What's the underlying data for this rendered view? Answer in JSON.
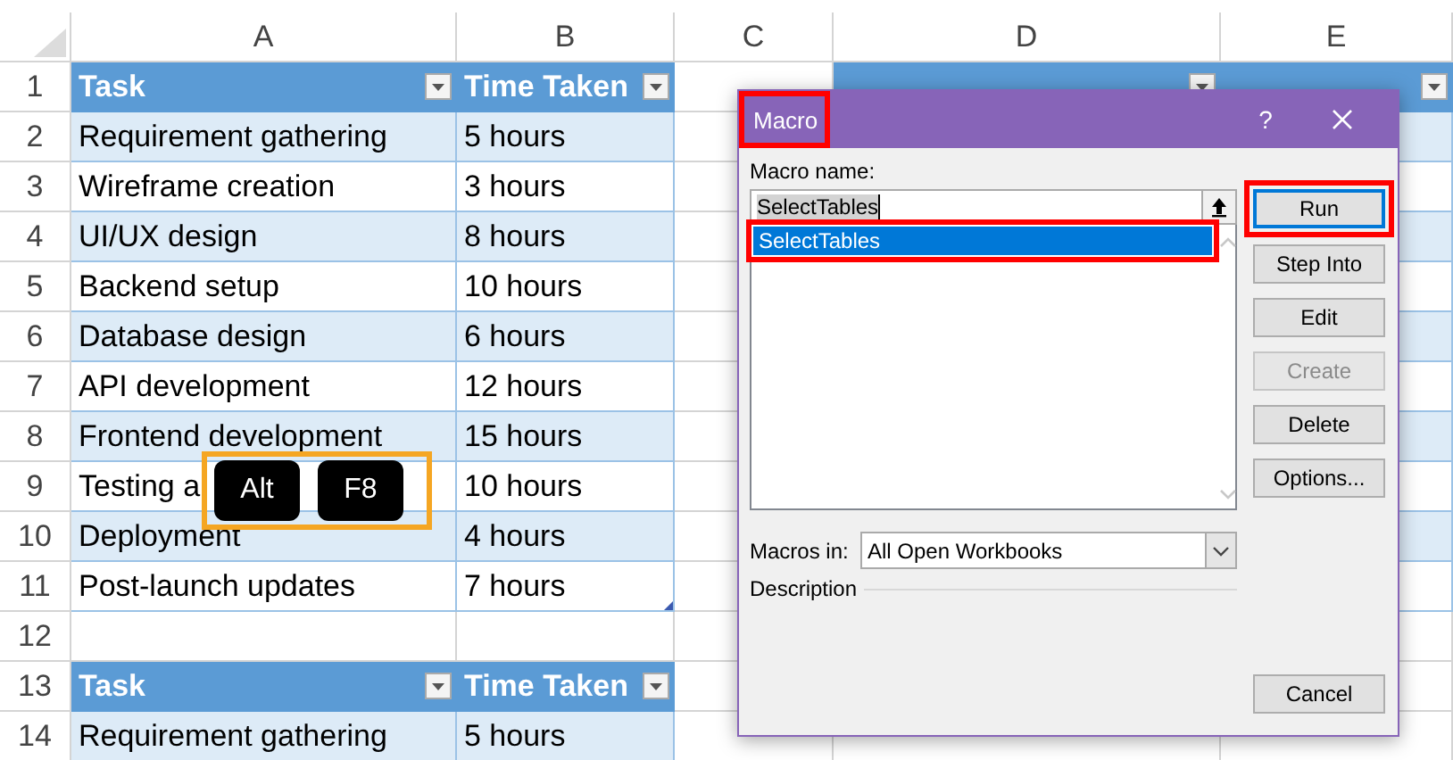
{
  "sheet": {
    "columns": [
      {
        "label": "A"
      },
      {
        "label": "B"
      },
      {
        "label": "C"
      },
      {
        "label": "D"
      },
      {
        "label": "E"
      }
    ],
    "rows": [
      {
        "number": "1",
        "cells": [
          {
            "kind": "header",
            "text": "Task",
            "filter": true
          },
          {
            "kind": "header",
            "text": "Time Taken",
            "filter": true
          },
          {
            "kind": "blank"
          },
          {
            "kind": "header",
            "filter": true
          },
          {
            "kind": "header",
            "filter": true
          }
        ]
      },
      {
        "number": "2",
        "cells": [
          {
            "kind": "band",
            "text": "Requirement gathering"
          },
          {
            "kind": "band",
            "text": "5 hours"
          },
          {
            "kind": "blank"
          },
          {
            "kind": "hidden"
          },
          {
            "kind": "band"
          }
        ]
      },
      {
        "number": "3",
        "cells": [
          {
            "kind": "plain",
            "text": "Wireframe creation"
          },
          {
            "kind": "plain",
            "text": "3 hours"
          },
          {
            "kind": "blank"
          },
          {
            "kind": "hidden"
          },
          {
            "kind": "plain"
          }
        ]
      },
      {
        "number": "4",
        "cells": [
          {
            "kind": "band",
            "text": "UI/UX design"
          },
          {
            "kind": "band",
            "text": "8 hours"
          },
          {
            "kind": "blank"
          },
          {
            "kind": "hidden"
          },
          {
            "kind": "band"
          }
        ]
      },
      {
        "number": "5",
        "cells": [
          {
            "kind": "plain",
            "text": "Backend setup"
          },
          {
            "kind": "plain",
            "text": "10 hours"
          },
          {
            "kind": "blank"
          },
          {
            "kind": "hidden"
          },
          {
            "kind": "plain"
          }
        ]
      },
      {
        "number": "6",
        "cells": [
          {
            "kind": "band",
            "text": "Database design"
          },
          {
            "kind": "band",
            "text": "6 hours"
          },
          {
            "kind": "blank"
          },
          {
            "kind": "hidden"
          },
          {
            "kind": "band"
          }
        ]
      },
      {
        "number": "7",
        "cells": [
          {
            "kind": "plain",
            "text": "API development"
          },
          {
            "kind": "plain",
            "text": "12 hours"
          },
          {
            "kind": "blank"
          },
          {
            "kind": "hidden"
          },
          {
            "kind": "plain"
          }
        ]
      },
      {
        "number": "8",
        "cells": [
          {
            "kind": "band",
            "text": "Frontend development"
          },
          {
            "kind": "band",
            "text": "15 hours"
          },
          {
            "kind": "blank"
          },
          {
            "kind": "hidden"
          },
          {
            "kind": "band"
          }
        ]
      },
      {
        "number": "9",
        "cells": [
          {
            "kind": "plain",
            "text": "Testing a"
          },
          {
            "kind": "plain",
            "text": "10 hours"
          },
          {
            "kind": "blank"
          },
          {
            "kind": "hidden"
          },
          {
            "kind": "plain"
          }
        ]
      },
      {
        "number": "10",
        "cells": [
          {
            "kind": "band",
            "text": "Deployment"
          },
          {
            "kind": "band",
            "text": "4 hours"
          },
          {
            "kind": "blank"
          },
          {
            "kind": "hidden"
          },
          {
            "kind": "band"
          }
        ]
      },
      {
        "number": "11",
        "cells": [
          {
            "kind": "plain",
            "text": "Post-launch updates"
          },
          {
            "kind": "plain",
            "text": "7 hours",
            "resize": true
          },
          {
            "kind": "blank"
          },
          {
            "kind": "hidden"
          },
          {
            "kind": "plain"
          }
        ]
      },
      {
        "number": "12",
        "cells": [
          {
            "kind": "blank"
          },
          {
            "kind": "blank"
          },
          {
            "kind": "blank"
          },
          {
            "kind": "hidden"
          },
          {
            "kind": "blank"
          }
        ]
      },
      {
        "number": "13",
        "cells": [
          {
            "kind": "header",
            "text": "Task",
            "filter": true
          },
          {
            "kind": "header",
            "text": "Time Taken",
            "filter": true
          },
          {
            "kind": "blank"
          },
          {
            "kind": "hidden"
          },
          {
            "kind": "blank"
          }
        ]
      },
      {
        "number": "14",
        "cells": [
          {
            "kind": "band",
            "text": "Requirement gathering"
          },
          {
            "kind": "band",
            "text": "5 hours"
          },
          {
            "kind": "blank"
          },
          {
            "kind": "blank"
          },
          {
            "kind": "blank"
          }
        ]
      }
    ]
  },
  "shortcut": {
    "keys": [
      "Alt",
      "F8"
    ]
  },
  "dialog": {
    "title": "Macro",
    "title_highlighted": true,
    "help": "?",
    "name_label": {
      "text": "Macro name:"
    },
    "name_value": "SelectTables",
    "macros": [
      {
        "text": "SelectTables",
        "selected": true,
        "highlighted": true
      }
    ],
    "buttons": [
      {
        "text": "Run",
        "default": true,
        "disabled": false,
        "highlighted": true
      },
      {
        "text": "Step Into",
        "default": false,
        "disabled": false,
        "highlighted": false
      },
      {
        "text": "Edit",
        "default": false,
        "disabled": false,
        "highlighted": false
      },
      {
        "text": "Create",
        "default": false,
        "disabled": true,
        "highlighted": false
      },
      {
        "text": "Delete",
        "default": false,
        "disabled": false,
        "highlighted": false
      },
      {
        "text": "Options...",
        "default": false,
        "disabled": false,
        "highlighted": false
      }
    ],
    "macros_in": {
      "label": "Macros in:",
      "value": "All Open Workbooks"
    },
    "description_label": "Description",
    "cancel": "Cancel"
  }
}
